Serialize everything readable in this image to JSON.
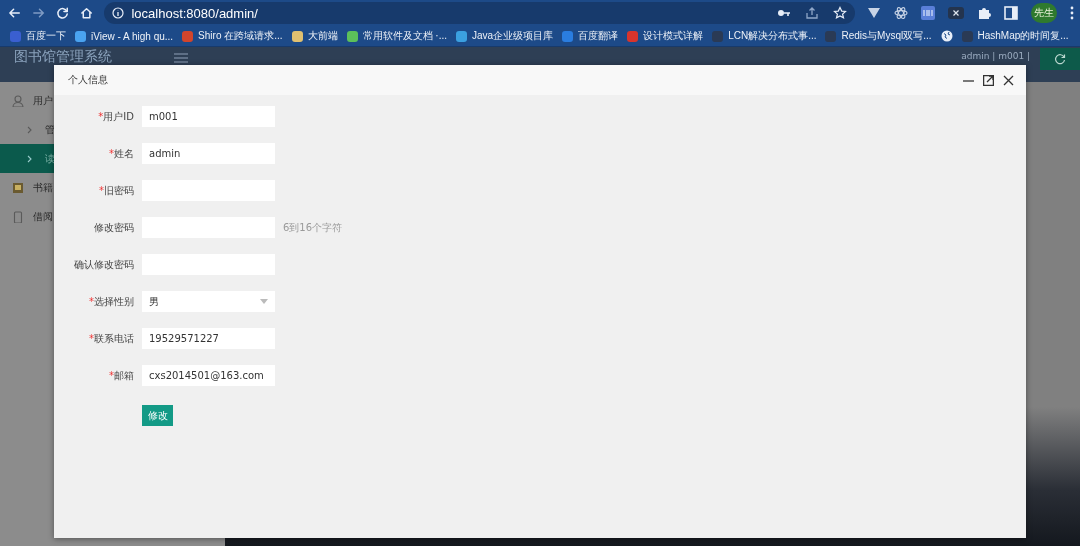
{
  "browser": {
    "url": "localhost:8080/admin/",
    "profile": "先生",
    "bookmarks": [
      {
        "kind": "site",
        "label": "百度一下",
        "color": "#3a5fd0"
      },
      {
        "kind": "site",
        "label": "iView - A high qu...",
        "color": "#4aa3f0"
      },
      {
        "kind": "site",
        "label": "Shiro 在跨域请求...",
        "color": "#d2452c"
      },
      {
        "kind": "site",
        "label": "大前端",
        "color": "#e0c070"
      },
      {
        "kind": "site",
        "label": "常用软件及文档 ·...",
        "color": "#5cc05a"
      },
      {
        "kind": "site",
        "label": "Java企业级项目库",
        "color": "#3ba0e0"
      },
      {
        "kind": "site",
        "label": "百度翻译",
        "color": "#2a7de0"
      },
      {
        "kind": "site",
        "label": "设计模式详解",
        "color": "#d8342c"
      },
      {
        "kind": "site",
        "label": "LCN解决分布式事...",
        "color": "#2a3a55"
      },
      {
        "kind": "site",
        "label": "Redis与Mysql双写...",
        "color": "#2a3a55"
      },
      {
        "kind": "globe"
      },
      {
        "kind": "site",
        "label": "HashMap的时间复...",
        "color": "#2a3a55"
      }
    ]
  },
  "app": {
    "title": "图书馆管理系统",
    "user_menu": "admin | m001 |",
    "sidebar": {
      "items": [
        {
          "kind": "user",
          "label": "用户",
          "selected": false
        },
        {
          "kind": "sub",
          "label": "管",
          "selected": false
        },
        {
          "kind": "sub",
          "label": "读",
          "selected": true
        },
        {
          "kind": "book",
          "label": "书籍",
          "selected": false
        },
        {
          "kind": "borrow",
          "label": "借阅",
          "selected": false
        }
      ]
    }
  },
  "modal": {
    "title": "个人信息",
    "fields": [
      {
        "kind": "text",
        "required_mark": "*",
        "label": "用户ID",
        "value": "m001"
      },
      {
        "kind": "text",
        "required_mark": "*",
        "label": "姓名",
        "value": "admin"
      },
      {
        "kind": "text",
        "required_mark": "*",
        "label": "旧密码"
      },
      {
        "kind": "text",
        "label": "修改密码",
        "hint": "6到16个字符"
      },
      {
        "kind": "text",
        "label": "确认修改密码"
      },
      {
        "kind": "select",
        "required_mark": "*",
        "label": "选择性别",
        "value": "男"
      },
      {
        "kind": "text",
        "required_mark": "*",
        "label": "联系电话",
        "value": "19529571227"
      },
      {
        "kind": "text",
        "required_mark": "*",
        "label": "邮箱",
        "value": "cxs2014501@163.com"
      }
    ],
    "submit": "修改"
  }
}
